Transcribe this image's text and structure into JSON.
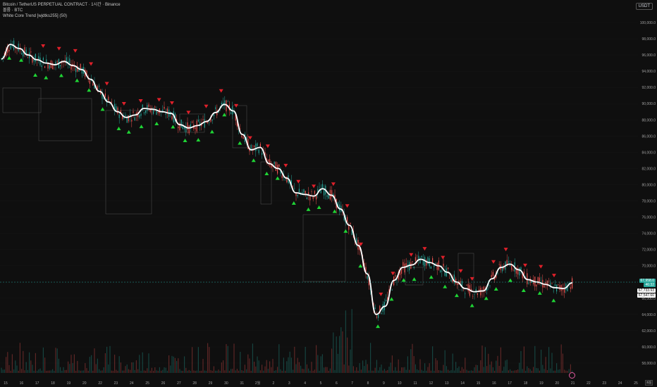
{
  "legend": {
    "title": "Bitcoin / TetherUS PERPETUAL CONTRACT · 1시간 · Binance",
    "volume": "볼륨 · BTC",
    "indicator": "White Core Trend [wjdtks255] (50)"
  },
  "currency": "USDT",
  "price_axis": [
    "100,000.0",
    "98,000.0",
    "96,000.0",
    "94,000.0",
    "92,000.0",
    "90,000.0",
    "88,000.0",
    "86,000.0",
    "84,000.0",
    "82,000.0",
    "80,000.0",
    "78,000.0",
    "76,000.0",
    "74,000.0",
    "72,000.0",
    "70,000.0",
    "66,000.0",
    "64,000.0",
    "62,000.0",
    "60,000.0",
    "58,000.0"
  ],
  "price_tags": {
    "last_price": "67,958.0",
    "countdown": "46:32",
    "trend_value": "67,733.93",
    "trend_value_2": "67,547.60"
  },
  "time_axis": [
    "15",
    "16",
    "17",
    "18",
    "19",
    "20",
    "22",
    "23",
    "24",
    "25",
    "26",
    "27",
    "28",
    "29",
    "30",
    "31",
    "2월",
    "2",
    "3",
    "4",
    "5",
    "6",
    "7",
    "8",
    "9",
    "10",
    "11",
    "12",
    "13",
    "14",
    "15",
    "16",
    "17",
    "18",
    "19",
    "20",
    "21",
    "22",
    "23",
    "24",
    "25"
  ],
  "colors": {
    "up": "#26a69a",
    "down": "#ef5350",
    "trend": "#ffffff",
    "buy": "#1fd435",
    "sell": "#e0202a",
    "background": "#0f0f0f"
  },
  "chart_data": {
    "type": "line",
    "series": [
      {
        "values": [
          95500,
          97300,
          96800,
          96000,
          95400,
          95000,
          94800,
          95200,
          94700,
          94200,
          93000,
          91500,
          90200,
          89000,
          88300,
          88600,
          89400,
          89300,
          89000,
          88800,
          87400,
          87000,
          87300,
          87800,
          88900,
          89900,
          89100,
          86200,
          84300,
          84600,
          82600,
          82000,
          80800,
          79000,
          78800,
          78600,
          79500,
          78700,
          77000,
          75000,
          72500,
          69000,
          64000,
          65000,
          68200,
          69800,
          70100,
          70800,
          70400,
          70000,
          69200,
          68000,
          67200,
          66800,
          66900,
          68400,
          69800,
          70200,
          69500,
          68300,
          68000,
          67700,
          67300,
          67200,
          67900
        ]
      }
    ],
    "buy_signals": 41,
    "sell_signals": 33
  },
  "footer": {
    "auto_label": "자동"
  }
}
